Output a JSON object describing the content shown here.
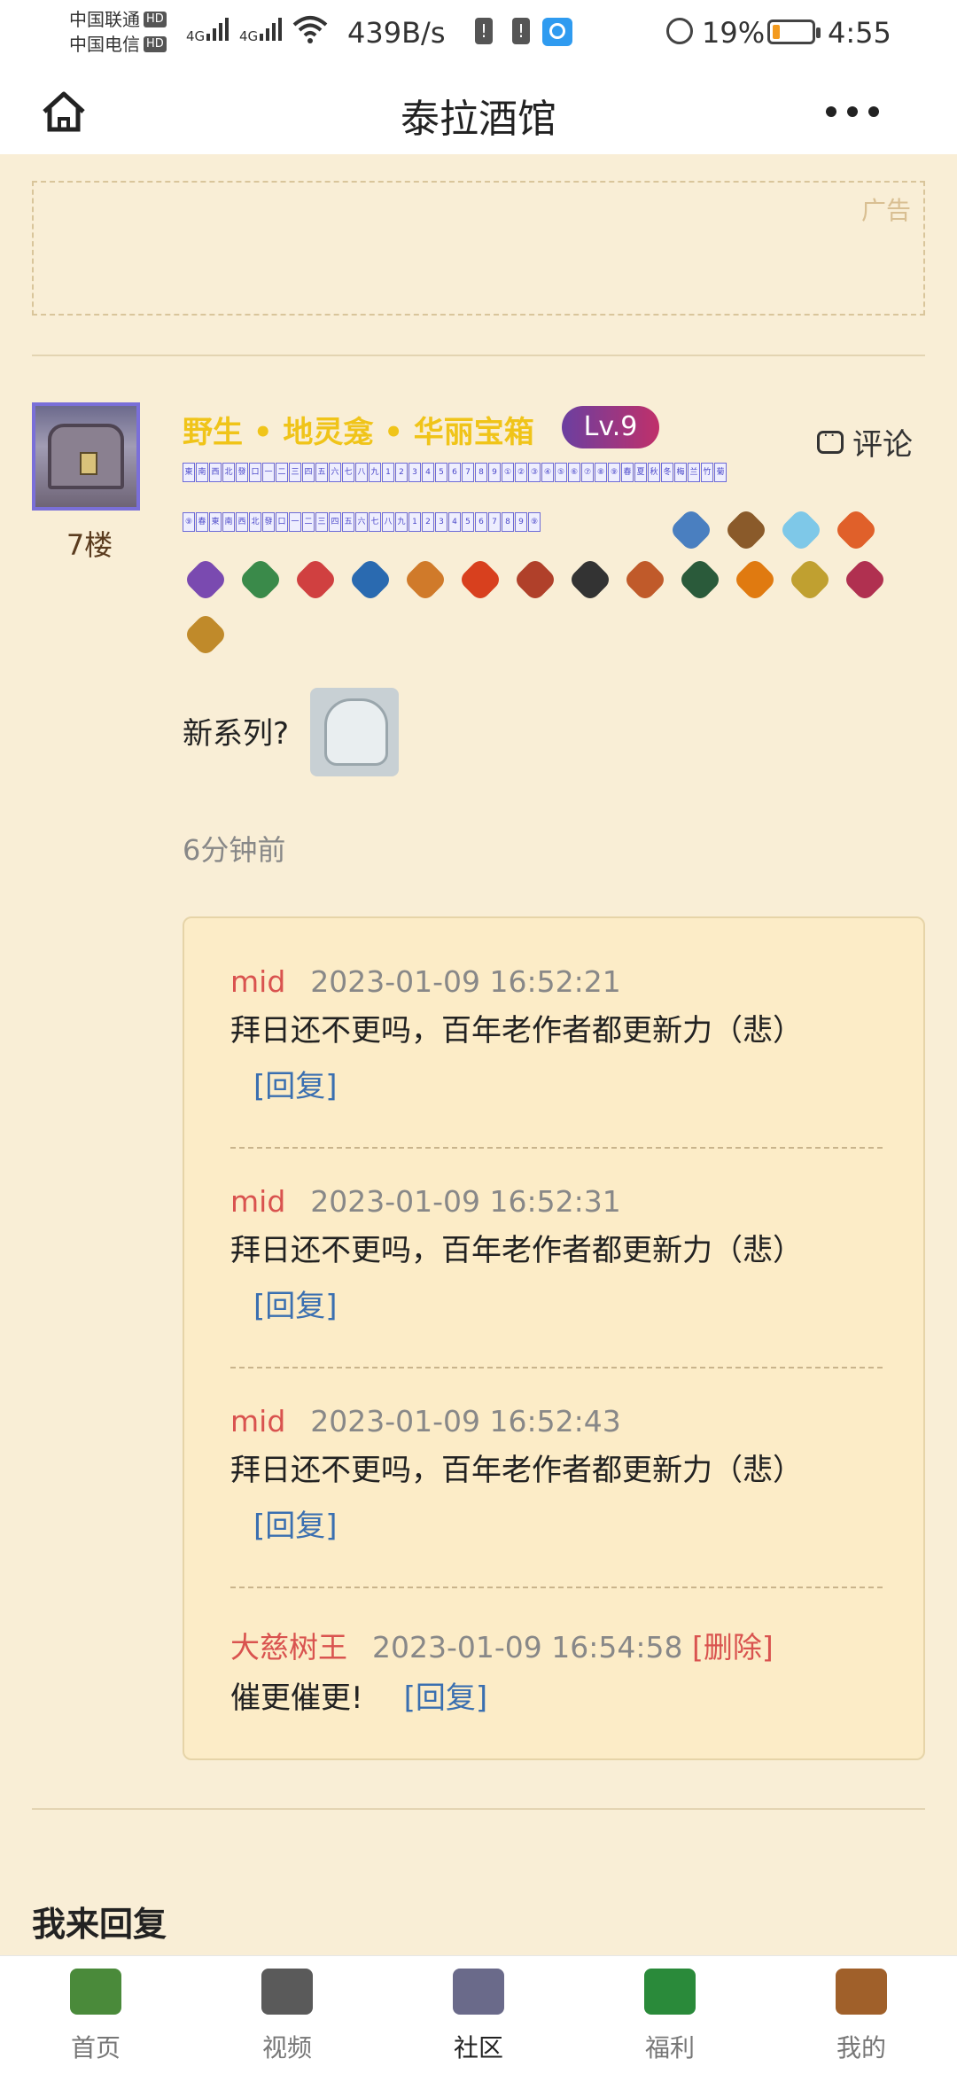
{
  "status_bar": {
    "carrier1": "中国联通",
    "carrier2": "中国电信",
    "hd": "HD",
    "net1": "4G",
    "net2": "4G",
    "speed": "439B/s",
    "battery_percent": "19%",
    "battery_level": 0.19,
    "time": "4:55"
  },
  "header": {
    "title": "泰拉酒馆",
    "home_icon": "home-icon",
    "more_icon": "more-dots-icon"
  },
  "ad": {
    "label": "广告"
  },
  "post": {
    "floor": "7楼",
    "username": "野生 • 地灵龛 • 华丽宝箱",
    "level": "Lv.9",
    "comment_label": "评论",
    "text": "新系列?",
    "time": "6分钟前",
    "tiles_row1": [
      "東",
      "南",
      "西",
      "北",
      "發",
      "口",
      "一",
      "二",
      "三",
      "四",
      "五",
      "六",
      "七",
      "八",
      "九",
      "1",
      "2",
      "3",
      "4",
      "5",
      "6",
      "7",
      "8",
      "9",
      "①",
      "②",
      "③",
      "④",
      "⑤",
      "⑥",
      "⑦",
      "⑧",
      "⑨",
      "春",
      "夏",
      "秋",
      "冬",
      "梅",
      "兰",
      "竹",
      "菊"
    ],
    "tiles_row2": [
      "⑨",
      "春",
      "東",
      "南",
      "西",
      "北",
      "發",
      "口",
      "一",
      "二",
      "三",
      "四",
      "五",
      "六",
      "七",
      "八",
      "九",
      "1",
      "2",
      "3",
      "4",
      "5",
      "6",
      "7",
      "8",
      "9",
      "⑨"
    ],
    "badges_row1": [
      {
        "icon": "mailbox-icon",
        "color": "#4a7fc0"
      },
      {
        "icon": "crossbow-icon",
        "color": "#8a5a2a"
      },
      {
        "icon": "feather-icon",
        "color": "#7ec8e8"
      },
      {
        "icon": "flame-sword-icon",
        "color": "#e0602a"
      }
    ],
    "badges_row2": [
      {
        "icon": "staff-icon",
        "color": "#7a4ab0"
      },
      {
        "icon": "wand-icon",
        "color": "#3a8a4a"
      },
      {
        "icon": "pot-icon",
        "color": "#d04040"
      },
      {
        "icon": "book-icon",
        "color": "#2a6ab0"
      },
      {
        "icon": "bag-icon",
        "color": "#d07a2a"
      },
      {
        "icon": "red-feather-icon",
        "color": "#d8401e"
      },
      {
        "icon": "trophy-icon",
        "color": "#b0402a"
      },
      {
        "icon": "black-feather-icon",
        "color": "#333333"
      },
      {
        "icon": "jar-icon",
        "color": "#c05a2a"
      },
      {
        "icon": "dark-feather-icon",
        "color": "#2a5a3a"
      },
      {
        "icon": "fire-ring-icon",
        "color": "#e07a10"
      },
      {
        "icon": "coins-icon",
        "color": "#c0a030"
      },
      {
        "icon": "eye-icon",
        "color": "#b03050"
      }
    ],
    "badges_row3": [
      {
        "icon": "potion-bag-icon",
        "color": "#c08a2a"
      }
    ]
  },
  "replies": [
    {
      "author": "mid",
      "time": "2023-01-09 16:52:21",
      "text": "拜日还不更吗，百年老作者都更新力（悲）",
      "reply_label": "[回复]"
    },
    {
      "author": "mid",
      "time": "2023-01-09 16:52:31",
      "text": "拜日还不更吗，百年老作者都更新力（悲）",
      "reply_label": "[回复]"
    },
    {
      "author": "mid",
      "time": "2023-01-09 16:52:43",
      "text": "拜日还不更吗，百年老作者都更新力（悲）",
      "reply_label": "[回复]"
    },
    {
      "author": "大慈树王",
      "time": "2023-01-09 16:54:58",
      "delete_label": "[删除]",
      "text": "催更催更!",
      "reply_label": "[回复]"
    }
  ],
  "my_reply_heading": "我来回复",
  "nav": [
    {
      "label": "首页",
      "icon": "book-home-icon",
      "color": "#4a8a3a",
      "active": false
    },
    {
      "label": "视频",
      "icon": "tv-icon",
      "color": "#5a5a5a",
      "active": false
    },
    {
      "label": "社区",
      "icon": "signboard-icon",
      "color": "#6a6a8a",
      "active": true
    },
    {
      "label": "福利",
      "icon": "gift-icon",
      "color": "#2a8a3a",
      "active": false
    },
    {
      "label": "我的",
      "icon": "guide-avatar-icon",
      "color": "#a0602a",
      "active": false
    }
  ]
}
